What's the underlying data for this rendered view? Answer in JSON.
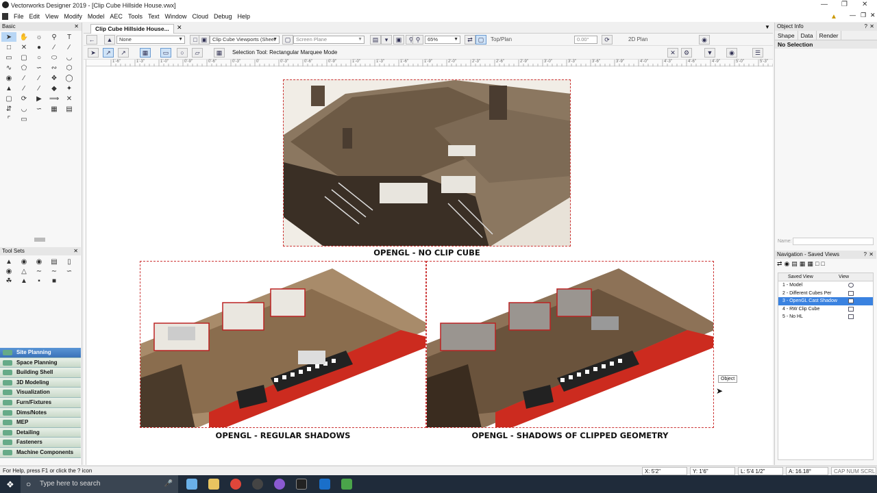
{
  "window": {
    "title": "Vectorworks Designer 2019 - [Clip Cube Hillside House.vwx]"
  },
  "menu": [
    "File",
    "Edit",
    "View",
    "Modify",
    "Model",
    "AEC",
    "Tools",
    "Text",
    "Window",
    "Cloud",
    "Debug",
    "Help"
  ],
  "left_panel": {
    "basic_title": "Basic",
    "toolsets_title": "Tool Sets",
    "tool_sets": [
      "Site Planning",
      "Space Planning",
      "Building Shell",
      "3D Modeling",
      "Visualization",
      "Furn/Fixtures",
      "Dims/Notes",
      "MEP",
      "Detailing",
      "Fasteners",
      "Machine Components"
    ],
    "selected_set": "Site Planning"
  },
  "document": {
    "tab_label": "Clip Cube Hillside House...",
    "class_select": "None",
    "viewport_select": "Clip Cube Viewports (Sheet",
    "plane_select": "Screen Plane",
    "zoom": "65%",
    "view": "Top/Plan",
    "rotation": "0.00°",
    "render_mode": "2D Plan",
    "mode_label": "Selection Tool: Rectangular Marquee Mode"
  },
  "ruler": {
    "ticks": [
      "1'-6\"",
      "1'-3\"",
      "1'-0\"",
      "0'-9\"",
      "0'-6\"",
      "0'-3\"",
      "0'",
      "0'-3\"",
      "0'-6\"",
      "0'-9\"",
      "1'-0\"",
      "1'-3\"",
      "1'-6\"",
      "1'-9\"",
      "2'-0\"",
      "2'-3\"",
      "2'-6\"",
      "2'-9\"",
      "3'-0\"",
      "3'-3\"",
      "3'-6\"",
      "3'-9\"",
      "4'-0\"",
      "4'-3\"",
      "4'-6\"",
      "4'-9\"",
      "5'-0\"",
      "5'-3\""
    ]
  },
  "canvas": {
    "captions": {
      "top": "OPENGL - NO CLIP CUBE",
      "bottom_left": "OPENGL - REGULAR SHADOWS",
      "bottom_right": "OPENGL - SHADOWS OF CLIPPED GEOMETRY"
    },
    "cursor_tooltip": "Object"
  },
  "right_panel": {
    "object_info_title": "Object Info",
    "tabs": [
      "Shape",
      "Data",
      "Render"
    ],
    "selection": "No Selection",
    "name_label": "Name:",
    "nav_title": "Navigation - Saved Views",
    "columns": [
      "Saved View",
      "View"
    ],
    "saved_views": [
      "1 - Model",
      "2 - Different Cubes Per",
      "3 - OpenGL Cast Shadow",
      "4 - RW Clip Cube",
      "5 - No HL"
    ],
    "selected_view": "3 - OpenGL Cast Shadow"
  },
  "status": {
    "help": "For Help, press F1 or click the ? icon",
    "x": "X: 5'2\"",
    "y": "Y: 1'6\"",
    "l": "L: 5'4 1/2\"",
    "a": "A: 16.18°",
    "flags": "CAP NUM SCRL"
  },
  "taskbar": {
    "search_placeholder": "Type here to search"
  }
}
